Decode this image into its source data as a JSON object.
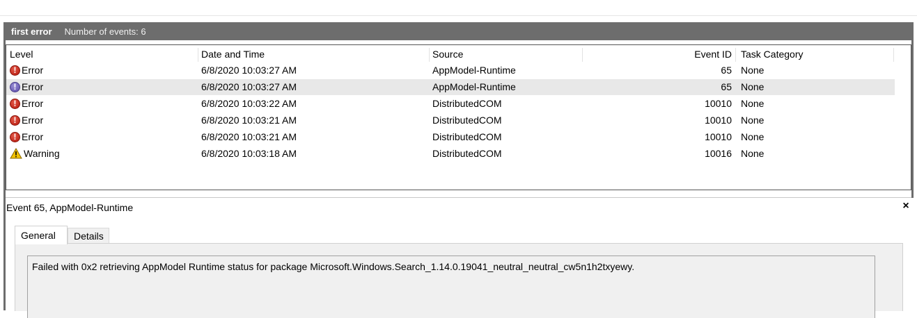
{
  "view": {
    "name": "first error",
    "count_text": "Number of events: 6"
  },
  "columns": [
    "Level",
    "Date and Time",
    "Source",
    "Event ID",
    "Task Category"
  ],
  "events": [
    {
      "level": "Error",
      "icon": "error-icon",
      "datetime": "6/8/2020 10:03:27 AM",
      "source": "AppModel-Runtime",
      "event_id": "65",
      "category": "None",
      "selected": false
    },
    {
      "level": "Error",
      "icon": "error-icon",
      "datetime": "6/8/2020 10:03:27 AM",
      "source": "AppModel-Runtime",
      "event_id": "65",
      "category": "None",
      "selected": true
    },
    {
      "level": "Error",
      "icon": "error-icon",
      "datetime": "6/8/2020 10:03:22 AM",
      "source": "DistributedCOM",
      "event_id": "10010",
      "category": "None",
      "selected": false
    },
    {
      "level": "Error",
      "icon": "error-icon",
      "datetime": "6/8/2020 10:03:21 AM",
      "source": "DistributedCOM",
      "event_id": "10010",
      "category": "None",
      "selected": false
    },
    {
      "level": "Error",
      "icon": "error-icon",
      "datetime": "6/8/2020 10:03:21 AM",
      "source": "DistributedCOM",
      "event_id": "10010",
      "category": "None",
      "selected": false
    },
    {
      "level": "Warning",
      "icon": "warning-icon",
      "datetime": "6/8/2020 10:03:18 AM",
      "source": "DistributedCOM",
      "event_id": "10016",
      "category": "None",
      "selected": false
    }
  ],
  "detail": {
    "title": "Event 65, AppModel-Runtime",
    "close_glyph": "×",
    "tabs": [
      "General",
      "Details"
    ],
    "message": "Failed with 0x2 retrieving AppModel Runtime status for package Microsoft.Windows.Search_1.14.0.19041_neutral_neutral_cw5n1h2txyewy."
  },
  "colors": {
    "titlebar": "#6d6d6d",
    "selected_row": "#e8e8e8",
    "error": "#c0180d",
    "warning": "#f2c200"
  }
}
